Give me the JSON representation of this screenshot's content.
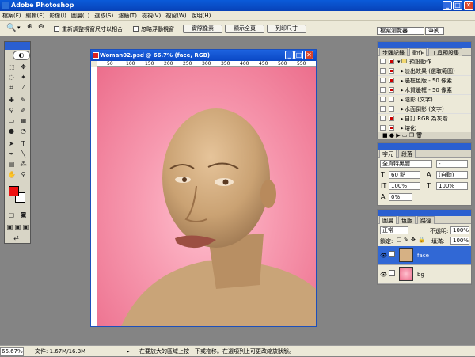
{
  "app": {
    "title": "Adobe Photoshop"
  },
  "menu": [
    "檔案(F)",
    "編輯(E)",
    "影像(I)",
    "圖層(L)",
    "選取(S)",
    "濾鏡(T)",
    "檢視(V)",
    "視窗(W)",
    "說明(H)"
  ],
  "options": {
    "resize_label": "重新調整視窗尺寸以相合",
    "ignore_label": "忽略浮動視窗",
    "actual_pixels": "實際像素",
    "fit_screen": "顯示全頁",
    "print_size": "列印尺寸",
    "file_browser": "檔案瀏覽器",
    "brushes": "筆刷"
  },
  "document": {
    "title": "Woman02.psd @ 66.7% (face, RGB)",
    "ruler_marks": [
      "50",
      "100",
      "150",
      "200",
      "250",
      "300",
      "350",
      "400",
      "450",
      "500",
      "550"
    ]
  },
  "actions_panel": {
    "tabs": [
      "步驟記錄",
      "動作",
      "工具預設集"
    ],
    "set_name": "預設動作",
    "items": [
      "淡出效果 (選取範圍)",
      "邊框色版 - 50 像素",
      "木質邊框 - 50 像素",
      "陰影 (文字)",
      "水面倒影 (文字)",
      "自訂 RGB 為灰階",
      "熔化"
    ]
  },
  "character_panel": {
    "tabs": [
      "字元",
      "段落"
    ],
    "font": "全真特黑體",
    "style": "-",
    "size": "60 點",
    "leading": "(自動)",
    "vscale": "100%",
    "hscale": "100%",
    "tracking": "0%"
  },
  "layers_panel": {
    "tabs": [
      "圖層",
      "色版",
      "路徑"
    ],
    "blend": "正常",
    "opacity_label": "不透明:",
    "opacity": "100%",
    "lock_label": "鎖定:",
    "fill_label": "填滿:",
    "fill": "100%",
    "layers": [
      {
        "name": "face",
        "selected": true
      },
      {
        "name": "bg",
        "selected": false
      }
    ]
  },
  "status": {
    "zoom": "66.67%",
    "doc": "文件: 1.67M/16.3M",
    "hint": "在要放大的區域上按一下或拖移。在選項列上可更改縮放狀態。"
  },
  "colors": {
    "foreground": "#ee1111",
    "background": "#ffffff",
    "canvas_bg": "#848484",
    "title_blue": "#0a5bd9"
  }
}
